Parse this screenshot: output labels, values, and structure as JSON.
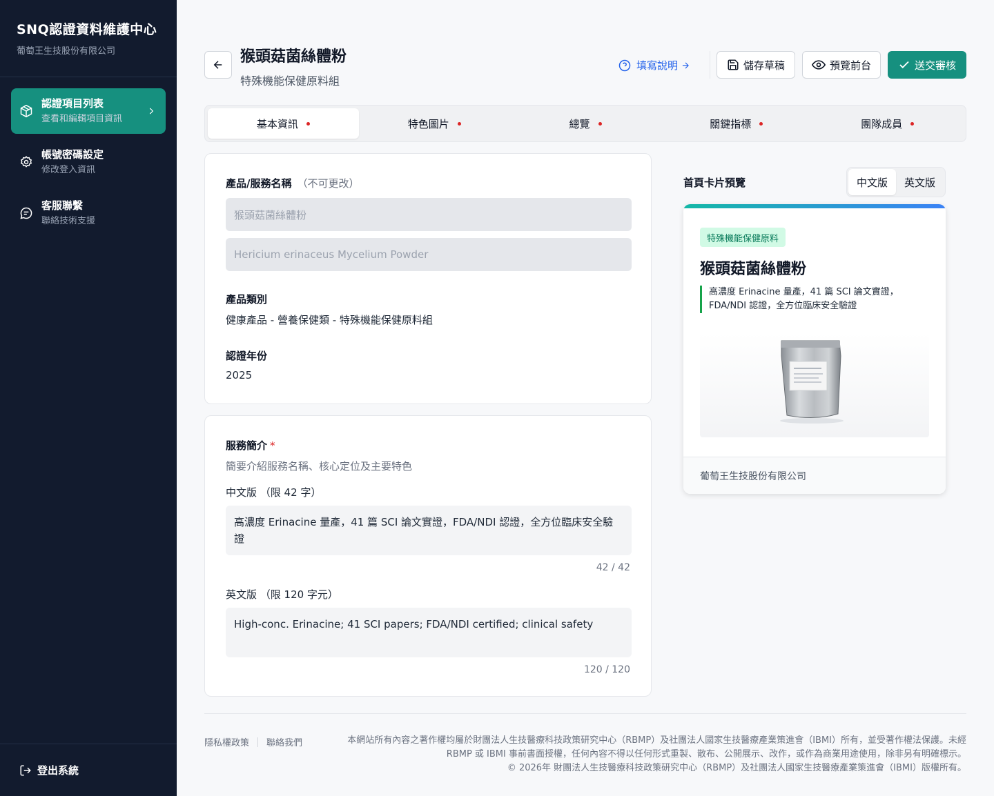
{
  "sidebar": {
    "brand_title": "SNQ認證資料維護中心",
    "brand_sub": "葡萄王生技股份有限公司",
    "items": [
      {
        "label": "認證項目列表",
        "sub": "查看和編輯項目資訊",
        "icon": "package-icon"
      },
      {
        "label": "帳號密碼設定",
        "sub": "修改登入資訊",
        "icon": "gear-icon"
      },
      {
        "label": "客服聯繫",
        "sub": "聯絡技術支援",
        "icon": "chat-icon"
      }
    ],
    "logout": "登出系統"
  },
  "header": {
    "title": "猴頭菇菌絲體粉",
    "subtitle": "特殊機能保健原料組",
    "help": "填寫說明",
    "save": "儲存草稿",
    "preview": "預覽前台",
    "submit": "送交審核"
  },
  "tabs": [
    {
      "label": "基本資訊"
    },
    {
      "label": "特色圖片"
    },
    {
      "label": "總覽"
    },
    {
      "label": "關鍵指標"
    },
    {
      "label": "團隊成員"
    }
  ],
  "basic": {
    "name_label": "產品/服務名稱",
    "name_hint": "（不可更改）",
    "name_zh": "猴頭菇菌絲體粉",
    "name_en": "Hericium erinaceus Mycelium Powder",
    "category_label": "產品類別",
    "category_value": "健康產品 - 營養保健類 - 特殊機能保健原料組",
    "year_label": "認證年份",
    "year_value": "2025"
  },
  "intro": {
    "label": "服務簡介",
    "required_mark": "*",
    "desc": "簡要介紹服務名稱、核心定位及主要特色",
    "zh_label": "中文版 （限 42 字）",
    "zh_value": "高濃度 Erinacine 量產，41 篇 SCI 論文實證，FDA/NDI 認證，全方位臨床安全驗證",
    "zh_counter": "42 / 42",
    "en_label": "英文版 （限 120 字元）",
    "en_value": "High-conc. Erinacine; 41 SCI papers; FDA/NDI certified; clinical safety",
    "en_counter": "120 / 120"
  },
  "preview": {
    "title": "首頁卡片預覽",
    "lang_zh": "中文版",
    "lang_en": "英文版",
    "tag": "特殊機能保健原料",
    "name": "猴頭菇菌絲體粉",
    "desc": "高濃度 Erinacine 量產，41 篇 SCI 論文實證，FDA/NDI 認證，全方位臨床安全驗證",
    "company": "葡萄王生技股份有限公司"
  },
  "footer": {
    "privacy": "隱私權政策",
    "contact": "聯絡我們",
    "copy_1": "本網站所有內容之著作權均屬於財團法人生技醫療科技政策研究中心（RBMP）及社團法人國家生技醫療產業策進會（IBMI）所有，並受著作權法保護。未經 RBMP 或 IBMI 事前書面授權，任何內容不得以任何形式重製、散布、公開展示、改作，或作為商業用途使用，除非另有明確標示。",
    "copy_2": "© 2026年 財團法人生技醫療科技政策研究中心（RBMP）及社團法人國家生技醫療產業策進會（IBMI）版權所有。"
  },
  "colors": {
    "sidebar_bg": "#121b2e",
    "accent": "#16907f",
    "link": "#2563eb",
    "required": "#dc2626"
  }
}
